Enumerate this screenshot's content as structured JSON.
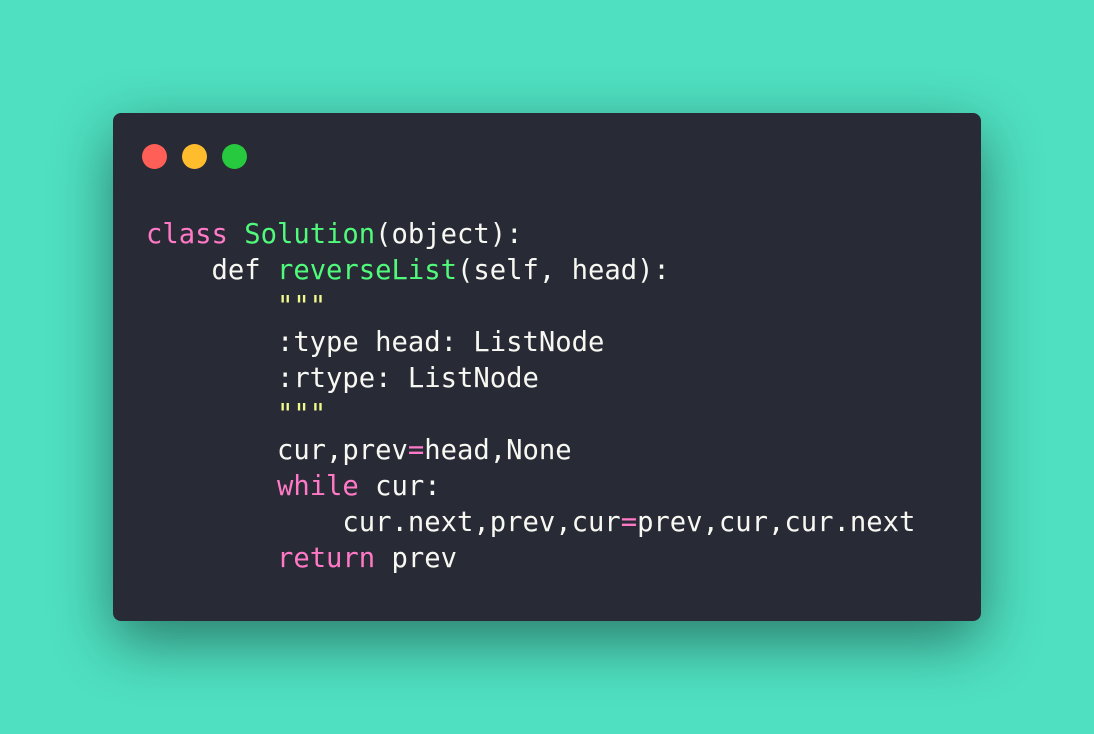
{
  "window": {
    "buttons": [
      {
        "name": "close",
        "color": "#ff5f56"
      },
      {
        "name": "minimize",
        "color": "#ffbd2e"
      },
      {
        "name": "maximize",
        "color": "#27c93f"
      }
    ],
    "background_color": "#4fe0c1",
    "editor_background": "#282a36"
  },
  "code": {
    "language": "python",
    "lines": [
      [
        {
          "text": "class",
          "kind": "kw"
        },
        {
          "text": " ",
          "kind": "plain"
        },
        {
          "text": "Solution",
          "kind": "fn"
        },
        {
          "text": "(object):",
          "kind": "plain"
        }
      ],
      [
        {
          "text": "    def ",
          "kind": "plain"
        },
        {
          "text": "reverseList",
          "kind": "fn"
        },
        {
          "text": "(self, head):",
          "kind": "plain"
        }
      ],
      [
        {
          "text": "        ",
          "kind": "plain"
        },
        {
          "text": "\"\"\"",
          "kind": "str"
        }
      ],
      [
        {
          "text": "        :type head: ListNode",
          "kind": "plain"
        }
      ],
      [
        {
          "text": "        :rtype: ListNode",
          "kind": "plain"
        }
      ],
      [
        {
          "text": "        ",
          "kind": "plain"
        },
        {
          "text": "\"\"\"",
          "kind": "str"
        }
      ],
      [
        {
          "text": "        cur,prev",
          "kind": "plain"
        },
        {
          "text": "=",
          "kind": "kw"
        },
        {
          "text": "head,None",
          "kind": "plain"
        }
      ],
      [
        {
          "text": "        ",
          "kind": "plain"
        },
        {
          "text": "while",
          "kind": "kw"
        },
        {
          "text": " cur:",
          "kind": "plain"
        }
      ],
      [
        {
          "text": "            cur.next,prev,cur",
          "kind": "plain"
        },
        {
          "text": "=",
          "kind": "kw"
        },
        {
          "text": "prev,cur,cur.next",
          "kind": "plain"
        }
      ],
      [
        {
          "text": "        ",
          "kind": "plain"
        },
        {
          "text": "return",
          "kind": "kw"
        },
        {
          "text": " prev",
          "kind": "plain"
        }
      ]
    ]
  }
}
